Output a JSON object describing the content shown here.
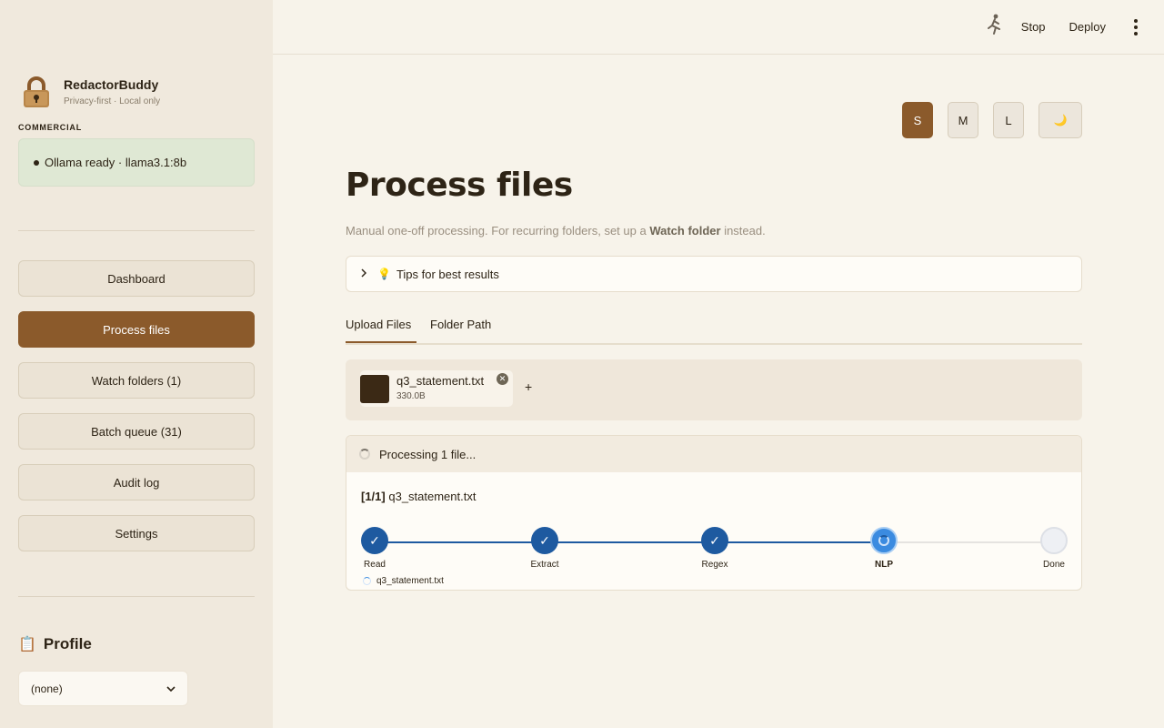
{
  "brand": {
    "title": "RedactorBuddy",
    "subtitle": "Privacy-first · Local only"
  },
  "tier": "COMMERCIAL",
  "status": {
    "text": "Ollama ready · llama3.1:8b",
    "color": "#dfe8d4"
  },
  "nav": [
    {
      "label": "Dashboard",
      "active": false
    },
    {
      "label": "Process files",
      "active": true
    },
    {
      "label": "Watch folders (1)",
      "active": false
    },
    {
      "label": "Batch queue (31)",
      "active": false
    },
    {
      "label": "Audit log",
      "active": false
    },
    {
      "label": "Settings",
      "active": false
    }
  ],
  "profile": {
    "heading": "Profile",
    "selected": "(none)"
  },
  "topbar": {
    "stop_label": "Stop",
    "deploy_label": "Deploy"
  },
  "sizes": {
    "s": "S",
    "m": "M",
    "l": "L",
    "active": "S",
    "theme_icon": "moon-icon"
  },
  "page": {
    "title": "Process files",
    "subtitle_pre": "Manual one-off processing. For recurring folders, set up a ",
    "subtitle_bold": "Watch folder",
    "subtitle_post": " instead."
  },
  "tips": {
    "label": "Tips for best results"
  },
  "tabs": {
    "upload": "Upload Files",
    "folder": "Folder Path",
    "active": "Upload Files"
  },
  "upload": {
    "file_name": "q3_statement.txt",
    "file_size": "330.0B",
    "add_label": "+"
  },
  "processing": {
    "header": "Processing 1 file...",
    "counter": "[1/1]",
    "file_name": "q3_statement.txt",
    "current_file": "q3_statement.txt",
    "steps": [
      {
        "label": "Read",
        "state": "done"
      },
      {
        "label": "Extract",
        "state": "done"
      },
      {
        "label": "Regex",
        "state": "done"
      },
      {
        "label": "NLP",
        "state": "active"
      },
      {
        "label": "Done",
        "state": "pending"
      }
    ]
  },
  "colors": {
    "accent": "#8b5a2b",
    "progress": "#1e5aa0",
    "active_step": "#3b8be0"
  }
}
